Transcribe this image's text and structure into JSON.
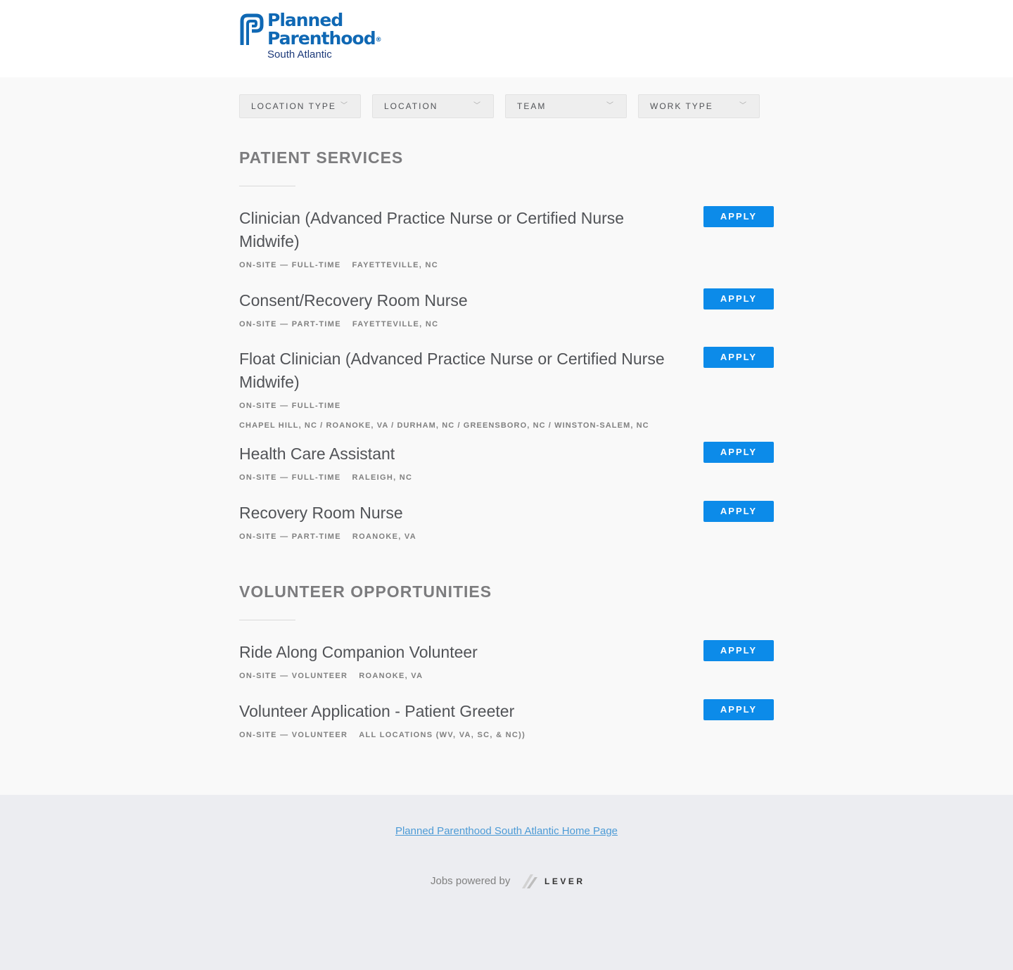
{
  "header": {
    "logo": {
      "line1": "Planned",
      "line2": "Parenthood",
      "registered": "®",
      "line3": "South Atlantic",
      "brand_color": "#0f68b4"
    }
  },
  "filters": [
    {
      "label": "LOCATION TYPE",
      "icon": "chevron-down-icon"
    },
    {
      "label": "LOCATION",
      "icon": "chevron-down-icon"
    },
    {
      "label": "TEAM",
      "icon": "chevron-down-icon"
    },
    {
      "label": "WORK TYPE",
      "icon": "chevron-down-icon"
    }
  ],
  "sections": [
    {
      "title": "PATIENT SERVICES",
      "postings": [
        {
          "title": "Clinician (Advanced Practice Nurse or Certified Nurse Midwife)",
          "commitment": "ON-SITE — FULL-TIME",
          "location": "FAYETTEVILLE, NC",
          "apply": "APPLY"
        },
        {
          "title": "Consent/Recovery Room Nurse",
          "commitment": "ON-SITE — PART-TIME",
          "location": "FAYETTEVILLE, NC",
          "apply": "APPLY"
        },
        {
          "title": "Float Clinician (Advanced Practice Nurse or Certified Nurse Midwife)",
          "commitment": "ON-SITE — FULL-TIME",
          "location": "CHAPEL HILL, NC / ROANOKE, VA / DURHAM, NC / GREENSBORO, NC / WINSTON-SALEM, NC",
          "apply": "APPLY"
        },
        {
          "title": "Health Care Assistant",
          "commitment": "ON-SITE — FULL-TIME",
          "location": "RALEIGH, NC",
          "apply": "APPLY"
        },
        {
          "title": "Recovery Room Nurse",
          "commitment": "ON-SITE — PART-TIME",
          "location": "ROANOKE, VA",
          "apply": "APPLY"
        }
      ]
    },
    {
      "title": "VOLUNTEER OPPORTUNITIES",
      "postings": [
        {
          "title": "Ride Along Companion Volunteer",
          "commitment": "ON-SITE — VOLUNTEER",
          "location": "ROANOKE, VA",
          "apply": "APPLY"
        },
        {
          "title": "Volunteer Application - Patient Greeter",
          "commitment": "ON-SITE — VOLUNTEER",
          "location": "ALL LOCATIONS (WV, VA, SC, & NC))",
          "apply": "APPLY"
        }
      ]
    }
  ],
  "footer": {
    "home_link": "Planned Parenthood South Atlantic Home Page",
    "powered_by": "Jobs powered by",
    "lever": "LEVER"
  },
  "colors": {
    "apply_button": "#0c8be9",
    "link": "#4d9bd6",
    "page_bg": "#f9f9f9",
    "footer_bg": "#ecedf1"
  }
}
